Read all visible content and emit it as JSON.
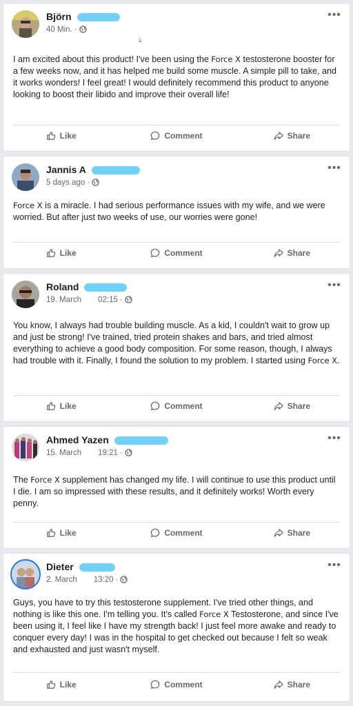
{
  "actions": {
    "like": "Like",
    "comment": "Comment",
    "share": "Share"
  },
  "posts": [
    {
      "name": "Björn",
      "time": "40 Min.",
      "clock": "",
      "text_before": "I am excited about this product! I've been using the ",
      "brand": "Force X",
      "text_after": " testosterone booster for a few weeks now, and it has helped me build some muscle. A simple pill to take, and it works wonders! I feel great! I would definitely recommend this product to anyone looking to boost their libido and improve their overall life!"
    },
    {
      "name": "Jannis A",
      "time": "5 days ago",
      "clock": "",
      "text_before": "",
      "brand": "Force X",
      "text_after": "  is a miracle. I had serious performance issues with my wife, and we were worried. But after just two weeks of use, our worries were gone!"
    },
    {
      "name": "Roland",
      "time": "19. March",
      "clock": "02:15",
      "text_before": "You know, I always had trouble building muscle. As a kid, I couldn't wait to grow up and just be strong! I've trained, tried protein shakes and bars, and tried almost everything to achieve a good body composition. For some reason, though, I always had trouble with it. Finally, I found the solution to my problem. I started using ",
      "brand": "Force X",
      "text_after": "."
    },
    {
      "name": "Ahmed Yazen",
      "time": "15. March",
      "clock": "19:21",
      "text_before": "The ",
      "brand": "Force X",
      "text_after": " supplement has changed my life. I will continue to use this product until I die. I am so impressed with these results, and it definitely works! Worth every penny."
    },
    {
      "name": "Dieter",
      "time": "2. March",
      "clock": "13:20",
      "text_before": "Guys, you have to try this testosterone supplement. I've tried other things, and nothing is like this one. I'm telling you. It's called ",
      "brand": "Force X",
      "text_after": "  Testosterone, and since I've been using it, I feel like I have my strength back! I just feel more awake and ready to conquer every day! I was in the hospital to get checked out because I felt so weak and exhausted and just wasn't myself."
    }
  ]
}
